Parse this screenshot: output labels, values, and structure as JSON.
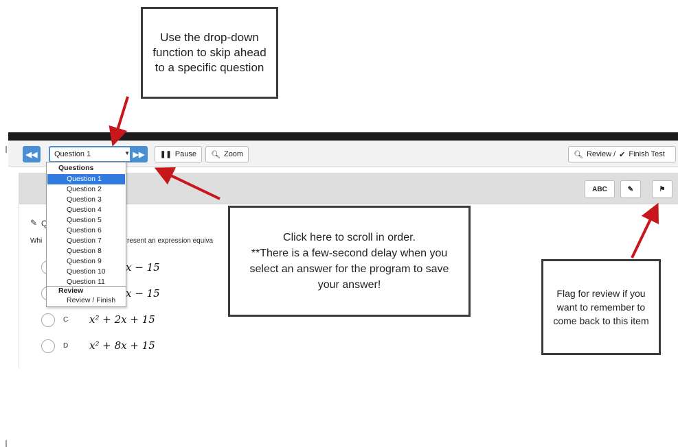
{
  "toolbar": {
    "back_icon": "double-chevron-left-icon",
    "question_select_value": "Question 1",
    "forward_icon": "double-chevron-right-icon",
    "pause_label": "Pause",
    "zoom_label": "Zoom",
    "review_label": "Review /",
    "finish_label": "Finish Test"
  },
  "tools": {
    "abc_label": "ABC",
    "edit_icon": "edit-icon",
    "flag_icon": "flag-icon"
  },
  "dropdown": {
    "questions_header": "Questions",
    "items": [
      "Question 1",
      "Question 2",
      "Question 3",
      "Question 4",
      "Question 5",
      "Question 6",
      "Question 7",
      "Question 8",
      "Question 9",
      "Question 10",
      "Question 11"
    ],
    "selected": "Question 1",
    "review_header": "Review",
    "review_item": "Review / Finish"
  },
  "question": {
    "prefix": "Q",
    "stem_left": "Whi",
    "stem_right": "resent an expression equiva",
    "choices": [
      {
        "letter": "",
        "expr_tail": "x − 15"
      },
      {
        "letter": "",
        "expr_tail": "x − 15"
      },
      {
        "letter": "C",
        "expr": "x² + 2x + 15"
      },
      {
        "letter": "D",
        "expr": "x² + 8x + 15"
      }
    ]
  },
  "callouts": {
    "dropdown_tip": "Use the drop-down function to skip ahead to a specific question",
    "scroll_tip_line1": "Click here to scroll in order.",
    "scroll_tip_line2": "**There is a few-second delay when you select an answer for the program to save your answer!",
    "flag_tip": "Flag for review if you want to remember to come back to this item"
  },
  "colors": {
    "accent_blue": "#4a8fd4",
    "selected_blue": "#2f7be0",
    "arrow_red": "#c8161d"
  }
}
